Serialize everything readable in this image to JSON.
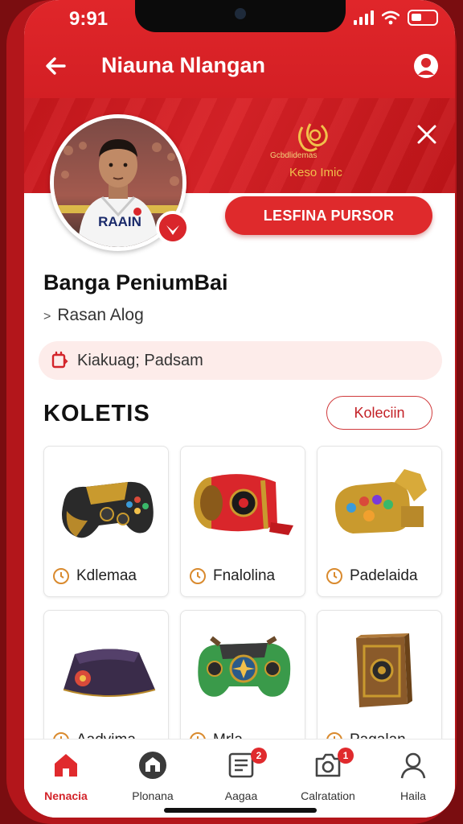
{
  "status_bar": {
    "time": "9:91"
  },
  "header": {
    "title": "Niauna Nlangan"
  },
  "banner": {
    "logo_small_text": "Gcbdlidemas",
    "subtitle": "Keso Imic"
  },
  "profile": {
    "primary_button_label": "LESFINA PURSOR",
    "name": "Banga PeniumBai",
    "handle": "Rasan Alog",
    "handle_chevron": ">",
    "jersey_text": "RAAIN",
    "info_text": "Kiakuag; Padsam"
  },
  "collection": {
    "title": "KOLETIS",
    "button_label": "Koleciin",
    "items": [
      {
        "label": "Kdlemaa",
        "icon": "gamepad-gold"
      },
      {
        "label": "Fnalolina",
        "icon": "red-cannon"
      },
      {
        "label": "Padelaida",
        "icon": "gold-gauntlet"
      },
      {
        "label": "Aadvima",
        "icon": "purple-pouch"
      },
      {
        "label": "Mrla",
        "icon": "green-gamepad"
      },
      {
        "label": "Pagalan",
        "icon": "bronze-book"
      }
    ]
  },
  "bottom_nav": {
    "items": [
      {
        "label": "Nenacia",
        "icon": "home-icon",
        "active": true
      },
      {
        "label": "Plonana",
        "icon": "shop-icon",
        "badge": ""
      },
      {
        "label": "Aagaa",
        "icon": "list-icon",
        "badge": "2"
      },
      {
        "label": "Calratation",
        "icon": "camera-icon",
        "badge": "1"
      },
      {
        "label": "Haila",
        "icon": "user-icon",
        "badge": ""
      }
    ]
  },
  "colors": {
    "primary": "#d9262b",
    "accent_gold": "#f1c04b",
    "pill_bg": "#fdecea"
  }
}
